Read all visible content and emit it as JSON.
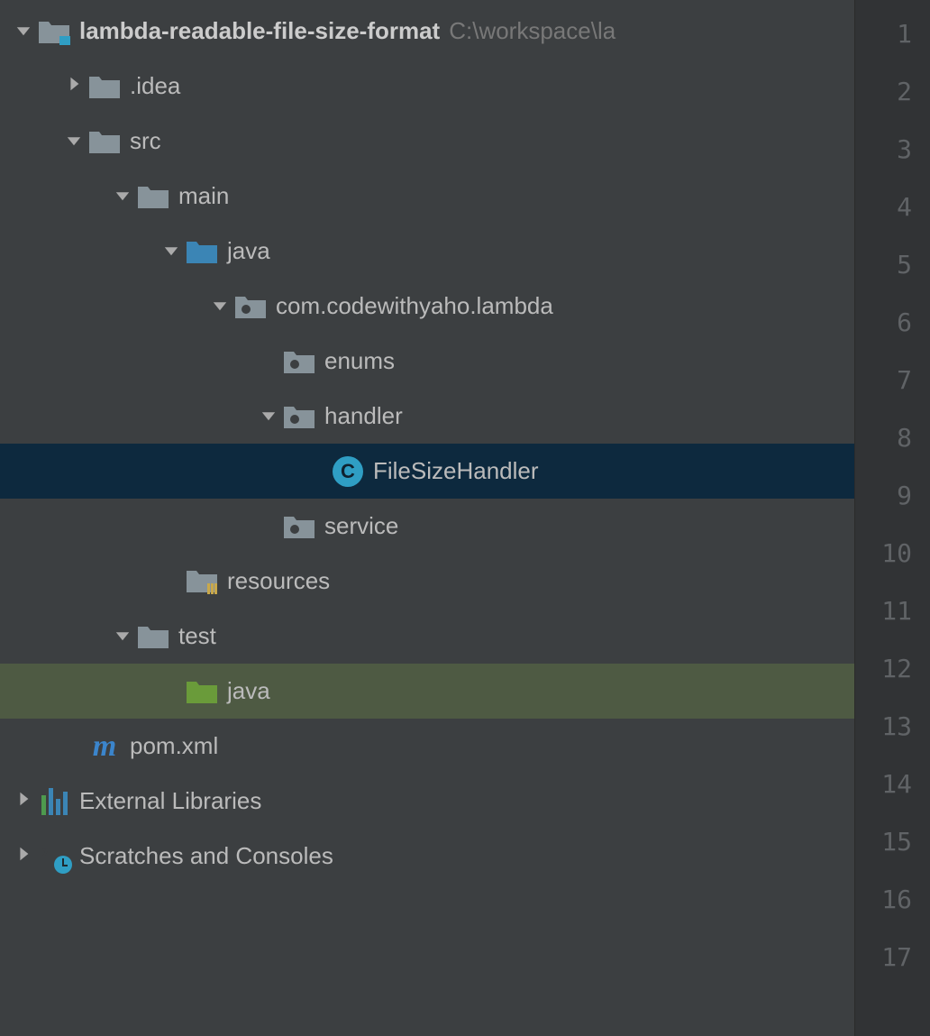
{
  "tree": {
    "root": {
      "name": "lambda-readable-file-size-format",
      "path": "C:\\workspace\\la"
    },
    "idea": ".idea",
    "src": "src",
    "main": "main",
    "java_main": "java",
    "pkg": "com.codewithyaho.lambda",
    "enums": "enums",
    "handler": "handler",
    "file_size_handler": "FileSizeHandler",
    "service": "service",
    "resources": "resources",
    "test": "test",
    "java_test": "java",
    "pom": "pom.xml",
    "external_libs": "External Libraries",
    "scratches": "Scratches and Consoles"
  },
  "gutter": {
    "lines": [
      "1",
      "2",
      "3",
      "4",
      "5",
      "6",
      "7",
      "8",
      "9",
      "10",
      "11",
      "12",
      "13",
      "14",
      "15",
      "16",
      "17"
    ]
  },
  "icons": {
    "class_letter": "C",
    "maven_letter": "m"
  }
}
